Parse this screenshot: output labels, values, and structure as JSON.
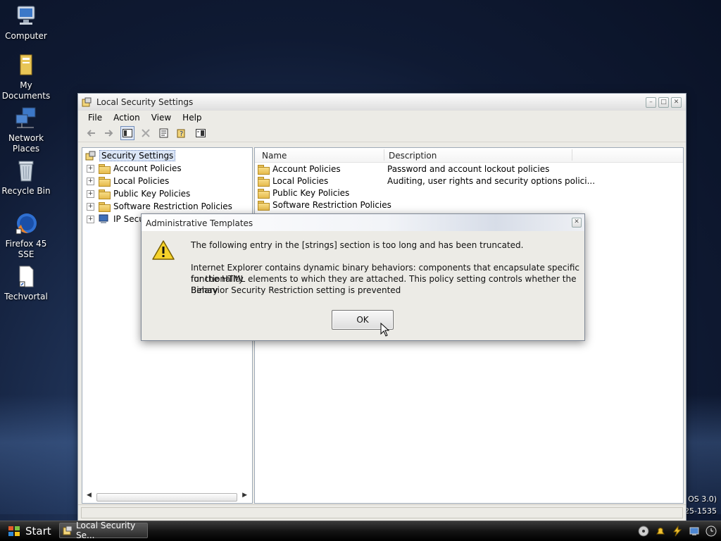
{
  "desktop": {
    "icons": [
      {
        "label": "Computer"
      },
      {
        "label": "My Documents"
      },
      {
        "label": "Network Places"
      },
      {
        "label": "Recycle Bin"
      },
      {
        "label": "Firefox 45 SSE"
      },
      {
        "label": "Techvortal"
      }
    ],
    "watermark_line1": "a OS 3.0)",
    "watermark_line2": "425-1535"
  },
  "window": {
    "title": "Local Security Settings",
    "menu": [
      "File",
      "Action",
      "View",
      "Help"
    ],
    "toolbar_icons": [
      "back-arrow-icon",
      "forward-arrow-icon",
      "show-hide-tree-icon",
      "delete-icon",
      "properties-icon",
      "help-icon",
      "export-list-icon"
    ],
    "tree": {
      "root": "Security Settings",
      "items": [
        {
          "label": "Account Policies"
        },
        {
          "label": "Local Policies"
        },
        {
          "label": "Public Key Policies"
        },
        {
          "label": "Software Restriction Policies"
        },
        {
          "label": "IP Secur"
        }
      ]
    },
    "list": {
      "columns": [
        "Name",
        "Description"
      ],
      "rows": [
        {
          "name": "Account Policies",
          "description": "Password and account lockout policies"
        },
        {
          "name": "Local Policies",
          "description": "Auditing, user rights and security options polici..."
        },
        {
          "name": "Public Key Policies",
          "description": ""
        },
        {
          "name": "Software Restriction Policies",
          "description": ""
        }
      ]
    }
  },
  "dialog": {
    "title": "Administrative Templates",
    "message_line1": "The following entry in the [strings] section is too long and has been truncated.",
    "message_line2": "Internet Explorer contains dynamic binary behaviors: components that encapsulate specific functionality",
    "message_line3": "for the HTML elements to which they are attached. This policy setting controls whether the Binary",
    "message_line4": "Behavior Security Restriction setting  is prevented",
    "ok_label": "OK"
  },
  "taskbar": {
    "start_label": "Start",
    "task_label": "Local Security Se..."
  }
}
